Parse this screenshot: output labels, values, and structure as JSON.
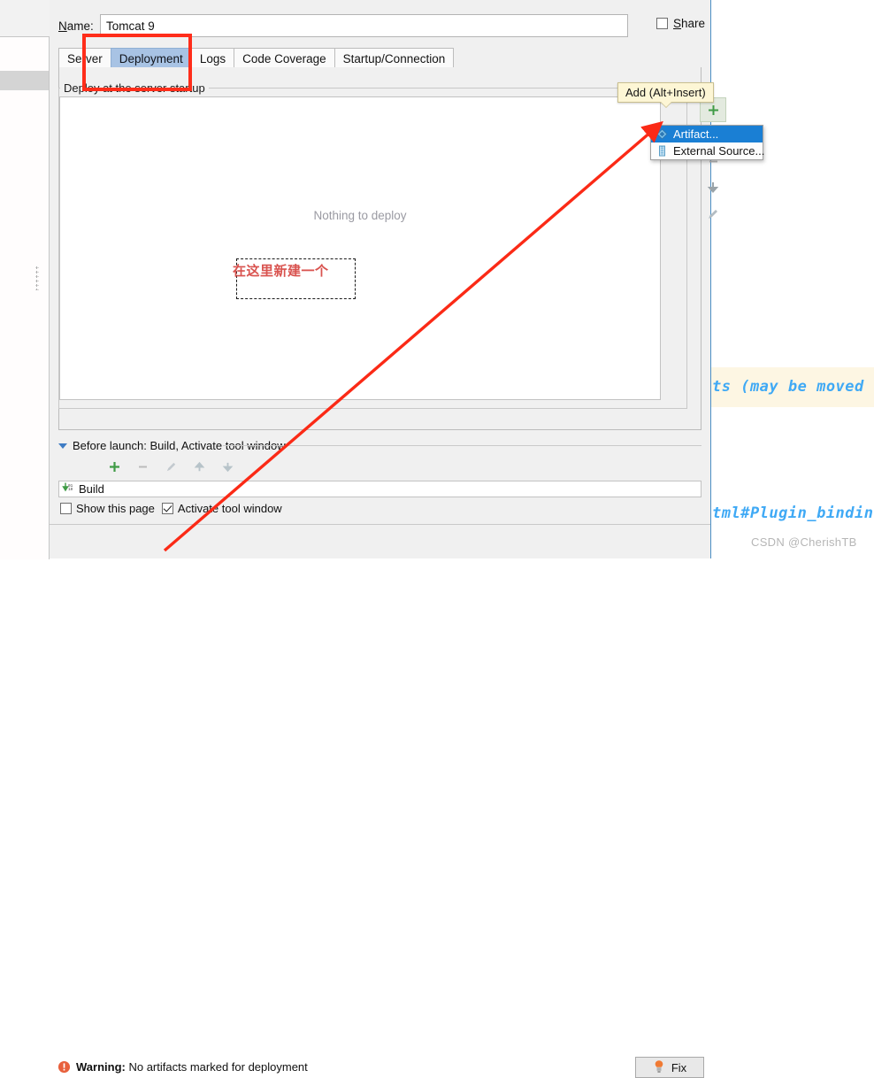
{
  "dialog": {
    "name_label": "Name:",
    "name_value": "Tomcat 9",
    "name_placeholder": "Name",
    "share_label": "Share",
    "share_checked": false,
    "tabs": [
      {
        "label": "Server",
        "active": false
      },
      {
        "label": "Deployment",
        "active": true
      },
      {
        "label": "Logs",
        "active": false
      },
      {
        "label": "Code Coverage",
        "active": false
      },
      {
        "label": "Startup/Connection",
        "active": false
      }
    ],
    "group_title": "Deploy at the server startup",
    "empty_list_text": "Nothing to deploy",
    "side_tools": [
      {
        "name": "add-icon",
        "glyph": "+",
        "enabled": true
      },
      {
        "name": "remove-icon",
        "glyph": "−",
        "enabled": false
      },
      {
        "name": "move-down-icon",
        "glyph": "↓",
        "enabled": false
      },
      {
        "name": "edit-pencil-icon",
        "glyph": "✎",
        "enabled": false
      }
    ],
    "tooltip": "Add (Alt+Insert)",
    "popup_menu": {
      "items": [
        {
          "label": "Artifact...",
          "icon": "artifact-diamond-icon",
          "selected": true
        },
        {
          "label": "External Source...",
          "icon": "external-source-icon",
          "selected": false
        }
      ]
    },
    "before_launch": {
      "title": "Before launch: Build, Activate tool window",
      "toolbar": [
        {
          "name": "add-icon",
          "glyph": "+",
          "enabled": true
        },
        {
          "name": "remove-icon",
          "glyph": "−",
          "enabled": false
        },
        {
          "name": "edit-pencil-icon",
          "glyph": "✎",
          "enabled": false
        },
        {
          "name": "move-up-icon",
          "glyph": "↑",
          "enabled": false
        },
        {
          "name": "move-down-icon",
          "glyph": "↓",
          "enabled": false
        }
      ],
      "items": [
        {
          "label": "Build",
          "icon": "build-icon"
        }
      ],
      "show_this_page_label": "Show this page",
      "show_this_page_checked": false,
      "activate_tool_window_label": "Activate tool window",
      "activate_tool_window_checked": true
    },
    "warning": {
      "prefix": "Warning:",
      "message": "No artifacts marked for deployment",
      "fix_label": "Fix"
    }
  },
  "annotations": {
    "note_text": "在这里新建一个",
    "note_color": "#d9534f",
    "highlight_color": "#ff2d1a"
  },
  "background_editor": {
    "line_1": "ts (may be moved t",
    "line_2": "tml#Plugin_bindin",
    "watermark": "CSDN @CherishTB",
    "code_color": "#3fa9f5"
  },
  "colors": {
    "accent_blue": "#1a7fd4",
    "tab_active": "#a8c3e4",
    "dialog_bg": "#f0f0f0",
    "warning_orange": "#e8603c",
    "add_green": "#3f9b45"
  }
}
